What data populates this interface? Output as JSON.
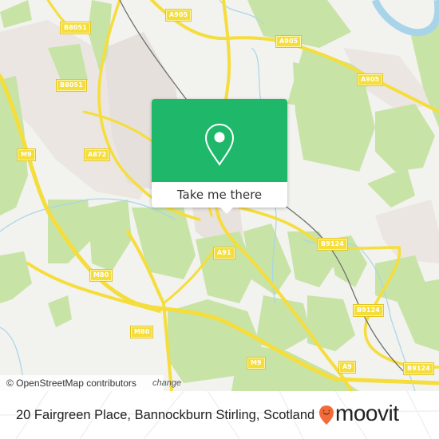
{
  "map": {
    "road_labels": [
      {
        "id": "b8051-north",
        "text": "B8051"
      },
      {
        "id": "a905-west",
        "text": "A905"
      },
      {
        "id": "a905-mid",
        "text": "A905"
      },
      {
        "id": "a905-east",
        "text": "A905"
      },
      {
        "id": "b8051-south",
        "text": "B8051"
      },
      {
        "id": "m9-west",
        "text": "M9"
      },
      {
        "id": "a872",
        "text": "A872"
      },
      {
        "id": "a91",
        "text": "A91"
      },
      {
        "id": "b9124-north",
        "text": "B9124"
      },
      {
        "id": "m80-north",
        "text": "M80"
      },
      {
        "id": "b9124-mid",
        "text": "B9124"
      },
      {
        "id": "m80-south",
        "text": "M80"
      },
      {
        "id": "m9-south",
        "text": "M9"
      },
      {
        "id": "a9",
        "text": "A9"
      },
      {
        "id": "b9124-south",
        "text": "B9124"
      }
    ],
    "attribution": "© OpenStreetMap contributors",
    "attribution_overflow": "change",
    "colors": {
      "land": "#f2f2ee",
      "park": "#c8e3a6",
      "urban": "#e8e2de",
      "water": "#a8d4ea",
      "road_major": "#f5dd3b",
      "railway": "#6e6e6e"
    }
  },
  "popup": {
    "icon": "map-pin-icon",
    "button_label": "Take me there",
    "color": "#1fb86b"
  },
  "footer": {
    "address": "20 Fairgreen Place, Bannockburn Stirling, Scotland",
    "logo_text": "moovit",
    "logo_color": "#f26b3a"
  }
}
